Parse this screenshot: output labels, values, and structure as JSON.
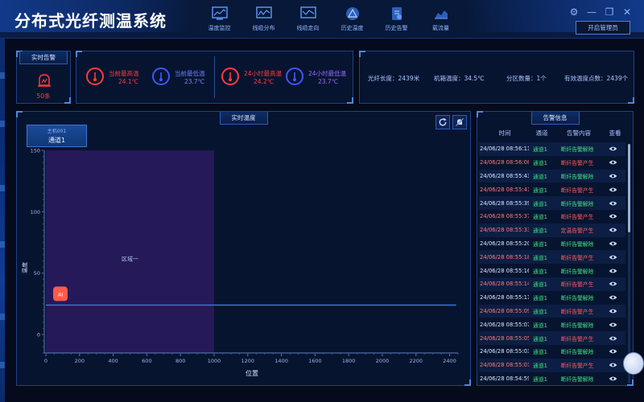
{
  "app": {
    "title": "分布式光纤测温系统"
  },
  "nav": [
    {
      "label": "温度监控",
      "icon": "monitor-chart-icon"
    },
    {
      "label": "线缆分布",
      "icon": "line-chart-icon"
    },
    {
      "label": "线缆走向",
      "icon": "trend-chart-icon"
    },
    {
      "label": "历史温度",
      "icon": "triangle-warning-icon"
    },
    {
      "label": "历史告警",
      "icon": "document-alarm-icon"
    },
    {
      "label": "载流量",
      "icon": "area-chart-icon"
    }
  ],
  "header": {
    "admin_button": "开启管理员"
  },
  "realtime_alarm": {
    "title": "实时告警",
    "count": "50条"
  },
  "temps": [
    {
      "label": "当前最高温",
      "value": "24.1℃",
      "color": "#ff3b3b"
    },
    {
      "label": "当前最低温",
      "value": "23.7℃",
      "color": "#4b6bff"
    },
    {
      "label": "24小时最高温",
      "value": "24.2℃",
      "color": "#ff3b3b"
    },
    {
      "label": "24小时最低温",
      "value": "23.7℃",
      "color": "#7b5cff"
    }
  ],
  "fiber": {
    "length": "光纤长度：2439米",
    "temp": "机箱温度：34.5℃",
    "zones": "分区数量：1个",
    "points": "有效温度点数：2439个"
  },
  "chart_panel": {
    "title": "实时温度",
    "channel_host": "主机001",
    "channel_name": "通道1"
  },
  "chart_data": {
    "type": "line",
    "title": "",
    "xlabel": "位置",
    "ylabel": "温度",
    "xlim": [
      0,
      2450
    ],
    "ylim": [
      -15,
      150
    ],
    "xticks": [
      0,
      200,
      400,
      600,
      800,
      1000,
      1200,
      1400,
      1600,
      1800,
      2000,
      2200,
      2400
    ],
    "yticks": [
      0,
      50,
      100,
      150
    ],
    "zone": {
      "name": "区域一",
      "x_start": 0,
      "x_end": 1000,
      "color": "#2a1a5e"
    },
    "series": [
      {
        "x": [
          0,
          600,
          1200,
          1800,
          2439
        ],
        "y": [
          24.0,
          24.0,
          24.0,
          24.0,
          24.0
        ],
        "color": "#2f7fe8"
      }
    ],
    "marker_label": "AI"
  },
  "alarm_panel": {
    "title": "告警信息",
    "headers": [
      "时间",
      "通道",
      "告警内容",
      "查看"
    ],
    "rows": [
      {
        "time": "24/06/28 08:56:11",
        "channel": "通道1",
        "content": "断纤告警解除",
        "status": "ok"
      },
      {
        "time": "24/06/28 08:56:08",
        "channel": "通道1",
        "content": "断纤告警产生",
        "status": "bad"
      },
      {
        "time": "24/06/28 08:55:43",
        "channel": "通道1",
        "content": "断纤告警解除",
        "status": "ok"
      },
      {
        "time": "24/06/28 08:55:41",
        "channel": "通道1",
        "content": "断纤告警产生",
        "status": "bad"
      },
      {
        "time": "24/06/28 08:55:39",
        "channel": "通道1",
        "content": "断纤告警解除",
        "status": "ok"
      },
      {
        "time": "24/06/28 08:55:37",
        "channel": "通道1",
        "content": "断纤告警产生",
        "status": "bad"
      },
      {
        "time": "24/06/28 08:55:33",
        "channel": "通道1",
        "content": "定温告警产生",
        "status": "bad"
      },
      {
        "time": "24/06/28 08:55:20",
        "channel": "通道1",
        "content": "断纤告警解除",
        "status": "ok"
      },
      {
        "time": "24/06/28 08:55:18",
        "channel": "通道1",
        "content": "断纤告警产生",
        "status": "bad"
      },
      {
        "time": "24/06/28 08:55:16",
        "channel": "通道1",
        "content": "断纤告警解除",
        "status": "ok"
      },
      {
        "time": "24/06/28 08:55:14",
        "channel": "通道1",
        "content": "断纤告警产生",
        "status": "bad"
      },
      {
        "time": "24/06/28 08:55:11",
        "channel": "通道1",
        "content": "断纤告警解除",
        "status": "ok"
      },
      {
        "time": "24/06/28 08:55:09",
        "channel": "通道1",
        "content": "断纤告警产生",
        "status": "bad"
      },
      {
        "time": "24/06/28 08:55:07",
        "channel": "通道1",
        "content": "断纤告警解除",
        "status": "ok"
      },
      {
        "time": "24/06/28 08:55:05",
        "channel": "通道1",
        "content": "断纤告警产生",
        "status": "bad"
      },
      {
        "time": "24/06/28 08:55:03",
        "channel": "通道1",
        "content": "断纤告警解除",
        "status": "ok"
      },
      {
        "time": "24/06/28 08:55:01",
        "channel": "通道1",
        "content": "断纤告警产生",
        "status": "bad"
      },
      {
        "time": "24/06/28 08:54:59",
        "channel": "通道1",
        "content": "断纤告警解除",
        "status": "ok"
      }
    ]
  }
}
